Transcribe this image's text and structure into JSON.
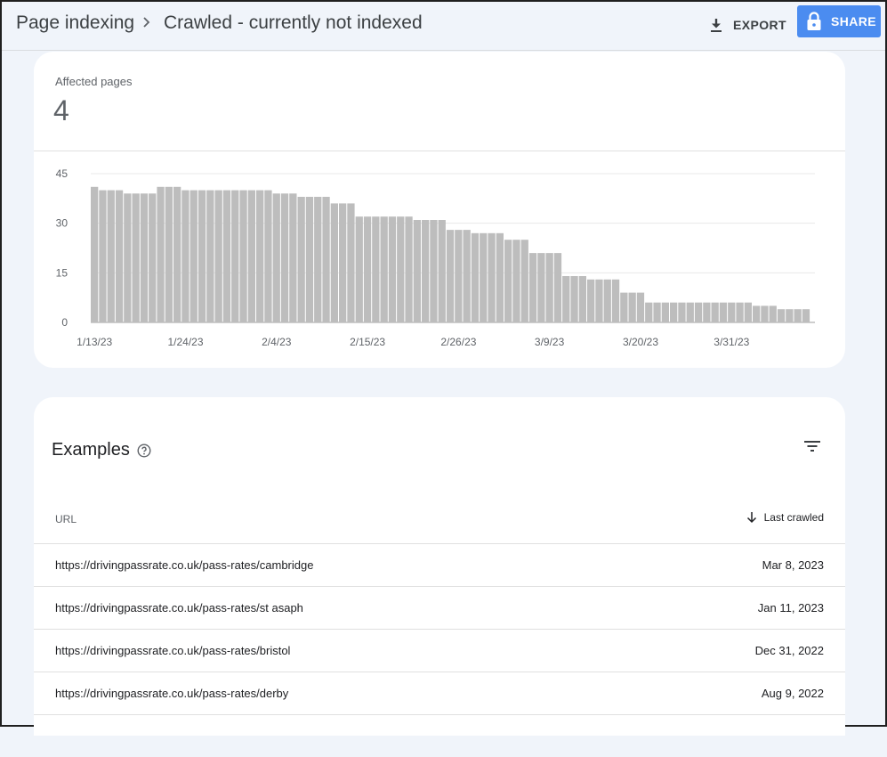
{
  "header": {
    "breadcrumb_root": "Page indexing",
    "title": "Crawled - currently not indexed",
    "export_label": "EXPORT",
    "share_label": "SHARE",
    "accent_color": "#4b8cf0"
  },
  "summary": {
    "affected_label": "Affected pages",
    "affected_value": "4"
  },
  "chart_data": {
    "type": "bar",
    "ylim": [
      0,
      45
    ],
    "yticks": [
      "45",
      "30",
      "15",
      "0"
    ],
    "xticks": [
      "1/13/23",
      "1/24/23",
      "2/4/23",
      "2/15/23",
      "2/26/23",
      "3/9/23",
      "3/20/23",
      "3/31/23"
    ],
    "bar_color": "#bdbdbd",
    "start_date": "1/13/23",
    "values": [
      41,
      40,
      40,
      40,
      39,
      39,
      39,
      39,
      41,
      41,
      41,
      40,
      40,
      40,
      40,
      40,
      40,
      40,
      40,
      40,
      40,
      40,
      39,
      39,
      39,
      38,
      38,
      38,
      38,
      36,
      36,
      36,
      32,
      32,
      32,
      32,
      32,
      32,
      32,
      31,
      31,
      31,
      31,
      28,
      28,
      28,
      27,
      27,
      27,
      27,
      25,
      25,
      25,
      21,
      21,
      21,
      21,
      14,
      14,
      14,
      13,
      13,
      13,
      13,
      9,
      9,
      9,
      6,
      6,
      6,
      6,
      6,
      6,
      6,
      6,
      6,
      6,
      6,
      6,
      6,
      5,
      5,
      5,
      4,
      4,
      4,
      4
    ]
  },
  "examples": {
    "title": "Examples",
    "col_url": "URL",
    "col_last_crawled": "Last crawled",
    "rows": [
      {
        "url": "https://drivingpassrate.co.uk/pass-rates/cambridge",
        "date": "Mar 8, 2023"
      },
      {
        "url": "https://drivingpassrate.co.uk/pass-rates/st asaph",
        "date": "Jan 11, 2023"
      },
      {
        "url": "https://drivingpassrate.co.uk/pass-rates/bristol",
        "date": "Dec 31, 2022"
      },
      {
        "url": "https://drivingpassrate.co.uk/pass-rates/derby",
        "date": "Aug 9, 2022"
      }
    ]
  }
}
